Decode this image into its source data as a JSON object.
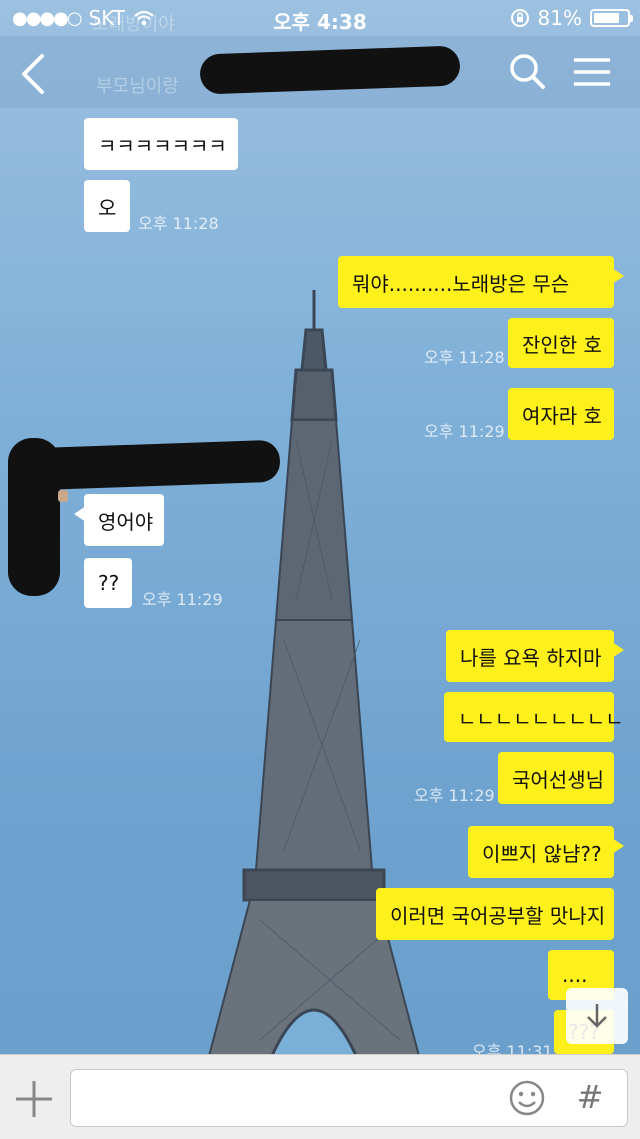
{
  "status_bar": {
    "carrier": "SKT",
    "time": "오후 4:38",
    "battery": "81%",
    "battery_level": 0.81
  },
  "header_hint": {
    "line1": "노래방이야",
    "line2": "부모님이랑"
  },
  "messages": [
    {
      "side": "left",
      "text": "ㅋㅋㅋㅋㅋㅋㅋ"
    },
    {
      "side": "left",
      "text": "오",
      "time": "오후 11:28"
    },
    {
      "side": "right",
      "text": "뭐야..........노래방은 무슨"
    },
    {
      "side": "right",
      "text": "잔인한 호",
      "time": "오후 11:28"
    },
    {
      "side": "right",
      "text": "여자라 호",
      "time": "오후 11:29"
    },
    {
      "side": "left",
      "text": "영어야"
    },
    {
      "side": "left",
      "text": "??",
      "time": "오후 11:29"
    },
    {
      "side": "right",
      "text": "나를 요욕 하지마"
    },
    {
      "side": "right",
      "text": "ㄴㄴㄴㄴㄴㄴㄴㄴㄴ"
    },
    {
      "side": "right",
      "text": "국어선생님",
      "time": "오후 11:29"
    },
    {
      "side": "right",
      "text": "이쁘지 않냠??"
    },
    {
      "side": "right",
      "text": "이러면 국어공부할 맛나지"
    },
    {
      "side": "right",
      "text": "...."
    },
    {
      "side": "right",
      "text": "???",
      "time": "오후 11:31"
    }
  ],
  "input": {
    "placeholder": "",
    "hash_label": "#"
  },
  "colors": {
    "bubble_yellow": "#fef01b",
    "bubble_white": "#ffffff"
  }
}
